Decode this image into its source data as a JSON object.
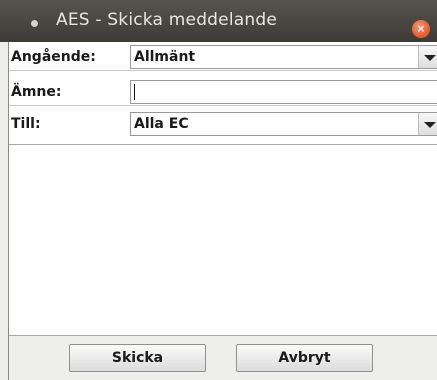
{
  "window": {
    "title": "AES - Skicka meddelande",
    "close_glyph": "×"
  },
  "form": {
    "subject_label": "Angående:",
    "subject_value": "Allmänt",
    "topic_label": "Ämne:",
    "topic_value": "",
    "to_label": "Till:",
    "to_value": "Alla EC"
  },
  "message": {
    "body": ""
  },
  "buttons": {
    "send_label": "Skicka",
    "cancel_label": "Avbryt"
  },
  "icons": {
    "window_menu": "window-menu-dot-icon",
    "close": "close-icon",
    "dropdown": "chevron-down-icon"
  },
  "colors": {
    "titlebar": "#3d3b37",
    "close_button": "#e25a2b",
    "window_bg": "#eeeeec"
  }
}
